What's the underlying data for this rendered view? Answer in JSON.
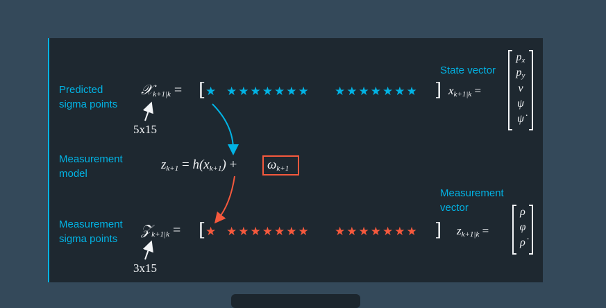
{
  "labels": {
    "predicted": "Predicted\nsigma points",
    "measurement_model": "Measurement\nmodel",
    "measurement_sigma": "Measurement\nsigma points",
    "state_vector": "State vector",
    "measurement_vector": "Measurement\nvector"
  },
  "dims": {
    "top": "5x15",
    "bottom": "3x15"
  },
  "stars": {
    "first": "★",
    "group1": "★★★★★★★",
    "group2": "★★★★★★★"
  },
  "state_vector_entries": [
    "p_x",
    "p_y",
    "v",
    "ψ",
    "ψ̇"
  ],
  "measurement_vector_entries": [
    "ρ",
    "φ",
    "ρ̇"
  ],
  "colors": {
    "accent": "#02b3e4",
    "red": "#f5593d",
    "text": "#f2f4f6",
    "panel": "#1e2830",
    "background": "#34495a"
  }
}
